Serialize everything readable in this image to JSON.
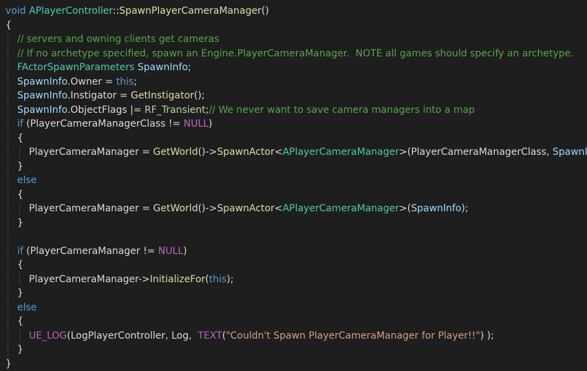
{
  "editor": {
    "theme": {
      "background": "#1e1e1e",
      "keyword": "#569cd6",
      "type": "#4ec9b0",
      "function": "#dcdcaa",
      "variable": "#9cdcfe",
      "comment": "#57a64a",
      "macro": "#bd63c5",
      "string": "#d69d85",
      "plain": "#dcdcdc"
    },
    "lines": [
      {
        "indent": 0,
        "tokens": [
          {
            "t": "void",
            "c": "kw"
          },
          {
            "t": " ",
            "c": "plain"
          },
          {
            "t": "APlayerController",
            "c": "type"
          },
          {
            "t": "::",
            "c": "plain"
          },
          {
            "t": "SpawnPlayerCameraManager",
            "c": "fn"
          },
          {
            "t": "()",
            "c": "plain"
          }
        ]
      },
      {
        "indent": 0,
        "tokens": [
          {
            "t": "{",
            "c": "plain"
          }
        ]
      },
      {
        "indent": 1,
        "tokens": [
          {
            "t": "// servers and owning clients get cameras",
            "c": "comment"
          }
        ]
      },
      {
        "indent": 1,
        "tokens": [
          {
            "t": "// If no archetype specified, spawn an Engine.PlayerCameraManager.  NOTE all games should specify an archetype.",
            "c": "comment"
          }
        ]
      },
      {
        "indent": 1,
        "tokens": [
          {
            "t": "FActorSpawnParameters",
            "c": "type"
          },
          {
            "t": " ",
            "c": "plain"
          },
          {
            "t": "SpawnInfo",
            "c": "var"
          },
          {
            "t": ";",
            "c": "plain"
          }
        ]
      },
      {
        "indent": 1,
        "tokens": [
          {
            "t": "SpawnInfo",
            "c": "var"
          },
          {
            "t": ".",
            "c": "plain"
          },
          {
            "t": "Owner",
            "c": "member"
          },
          {
            "t": " = ",
            "c": "plain"
          },
          {
            "t": "this",
            "c": "kw"
          },
          {
            "t": ";",
            "c": "plain"
          }
        ]
      },
      {
        "indent": 1,
        "tokens": [
          {
            "t": "SpawnInfo",
            "c": "var"
          },
          {
            "t": ".",
            "c": "plain"
          },
          {
            "t": "Instigator",
            "c": "member"
          },
          {
            "t": " = ",
            "c": "plain"
          },
          {
            "t": "GetInstigator",
            "c": "fn"
          },
          {
            "t": "();",
            "c": "plain"
          }
        ]
      },
      {
        "indent": 1,
        "tokens": [
          {
            "t": "SpawnInfo",
            "c": "var"
          },
          {
            "t": ".",
            "c": "plain"
          },
          {
            "t": "ObjectFlags",
            "c": "member"
          },
          {
            "t": " |= ",
            "c": "plain"
          },
          {
            "t": "RF_Transient",
            "c": "enum"
          },
          {
            "t": ";",
            "c": "plain"
          },
          {
            "t": "// We never want to save camera managers into a map",
            "c": "comment"
          }
        ]
      },
      {
        "indent": 1,
        "tokens": [
          {
            "t": "if",
            "c": "kw"
          },
          {
            "t": " (",
            "c": "plain"
          },
          {
            "t": "PlayerCameraManagerClass",
            "c": "member"
          },
          {
            "t": " != ",
            "c": "plain"
          },
          {
            "t": "NULL",
            "c": "macro"
          },
          {
            "t": ")",
            "c": "plain"
          }
        ]
      },
      {
        "indent": 1,
        "tokens": [
          {
            "t": "{",
            "c": "plain"
          }
        ]
      },
      {
        "indent": 2,
        "tokens": [
          {
            "t": "PlayerCameraManager",
            "c": "member"
          },
          {
            "t": " = ",
            "c": "plain"
          },
          {
            "t": "GetWorld",
            "c": "fn"
          },
          {
            "t": "()->",
            "c": "plain"
          },
          {
            "t": "SpawnActor",
            "c": "fn"
          },
          {
            "t": "<",
            "c": "plain"
          },
          {
            "t": "APlayerCameraManager",
            "c": "type"
          },
          {
            "t": ">(",
            "c": "plain"
          },
          {
            "t": "PlayerCameraManagerClass",
            "c": "member"
          },
          {
            "t": ", ",
            "c": "plain"
          },
          {
            "t": "SpawnInfo",
            "c": "var"
          },
          {
            "t": ");",
            "c": "plain"
          }
        ]
      },
      {
        "indent": 1,
        "tokens": [
          {
            "t": "}",
            "c": "plain"
          }
        ]
      },
      {
        "indent": 1,
        "tokens": [
          {
            "t": "else",
            "c": "kw"
          }
        ]
      },
      {
        "indent": 1,
        "tokens": [
          {
            "t": "{",
            "c": "plain"
          }
        ]
      },
      {
        "indent": 2,
        "tokens": [
          {
            "t": "PlayerCameraManager",
            "c": "member"
          },
          {
            "t": " = ",
            "c": "plain"
          },
          {
            "t": "GetWorld",
            "c": "fn"
          },
          {
            "t": "()->",
            "c": "plain"
          },
          {
            "t": "SpawnActor",
            "c": "fn"
          },
          {
            "t": "<",
            "c": "plain"
          },
          {
            "t": "APlayerCameraManager",
            "c": "type"
          },
          {
            "t": ">(",
            "c": "plain"
          },
          {
            "t": "SpawnInfo",
            "c": "var"
          },
          {
            "t": ");",
            "c": "plain"
          }
        ]
      },
      {
        "indent": 1,
        "tokens": [
          {
            "t": "}",
            "c": "plain"
          }
        ]
      },
      {
        "indent": 1,
        "tokens": []
      },
      {
        "indent": 1,
        "tokens": [
          {
            "t": "if",
            "c": "kw"
          },
          {
            "t": " (",
            "c": "plain"
          },
          {
            "t": "PlayerCameraManager",
            "c": "member"
          },
          {
            "t": " != ",
            "c": "plain"
          },
          {
            "t": "NULL",
            "c": "macro"
          },
          {
            "t": ")",
            "c": "plain"
          }
        ]
      },
      {
        "indent": 1,
        "tokens": [
          {
            "t": "{",
            "c": "plain"
          }
        ]
      },
      {
        "indent": 2,
        "tokens": [
          {
            "t": "PlayerCameraManager",
            "c": "member"
          },
          {
            "t": "->",
            "c": "plain"
          },
          {
            "t": "InitializeFor",
            "c": "fn"
          },
          {
            "t": "(",
            "c": "plain"
          },
          {
            "t": "this",
            "c": "kw"
          },
          {
            "t": ");",
            "c": "plain"
          }
        ]
      },
      {
        "indent": 1,
        "tokens": [
          {
            "t": "}",
            "c": "plain"
          }
        ]
      },
      {
        "indent": 1,
        "tokens": [
          {
            "t": "else",
            "c": "kw"
          }
        ]
      },
      {
        "indent": 1,
        "tokens": [
          {
            "t": "{",
            "c": "plain"
          }
        ]
      },
      {
        "indent": 2,
        "tokens": [
          {
            "t": "UE_LOG",
            "c": "macro"
          },
          {
            "t": "(",
            "c": "plain"
          },
          {
            "t": "LogPlayerController",
            "c": "member"
          },
          {
            "t": ", ",
            "c": "plain"
          },
          {
            "t": "Log",
            "c": "member"
          },
          {
            "t": ",  ",
            "c": "plain"
          },
          {
            "t": "TEXT",
            "c": "macro"
          },
          {
            "t": "(",
            "c": "plain"
          },
          {
            "t": "\"Couldn't Spawn PlayerCameraManager for Player!!\"",
            "c": "string"
          },
          {
            "t": ") );",
            "c": "plain"
          }
        ]
      },
      {
        "indent": 1,
        "tokens": [
          {
            "t": "}",
            "c": "plain"
          }
        ]
      },
      {
        "indent": 0,
        "tokens": [
          {
            "t": "}",
            "c": "plain"
          }
        ]
      }
    ]
  }
}
